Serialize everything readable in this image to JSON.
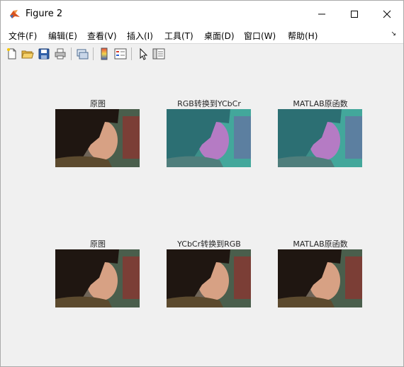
{
  "window": {
    "title": "Figure 2"
  },
  "menu": [
    "文件(F)",
    "编辑(E)",
    "查看(V)",
    "插入(I)",
    "工具(T)",
    "桌面(D)",
    "窗口(W)",
    "帮助(H)"
  ],
  "toolbar": {
    "icons": [
      "new-figure-icon",
      "open-file-icon",
      "save-icon",
      "print-icon",
      "link-icon",
      "colorbar-icon",
      "legend-icon",
      "pointer-icon",
      "property-inspector-icon"
    ]
  },
  "subplots": [
    {
      "title": "原图",
      "tint": "original"
    },
    {
      "title": "RGB转换到YCbCr",
      "tint": "ycbcr"
    },
    {
      "title": "MATLAB原函数",
      "tint": "ycbcr"
    },
    {
      "title": "原图",
      "tint": "original"
    },
    {
      "title": "YCbCr转换到RGB",
      "tint": "original"
    },
    {
      "title": "MATLAB原函数",
      "tint": "original"
    }
  ],
  "colors": {
    "original_bg_left": "#7a6a5e",
    "original_bg_right": "#3f5a48",
    "ycbcr_bg": "#3f9c95",
    "ycbcr_skin": "#b07ac0"
  }
}
